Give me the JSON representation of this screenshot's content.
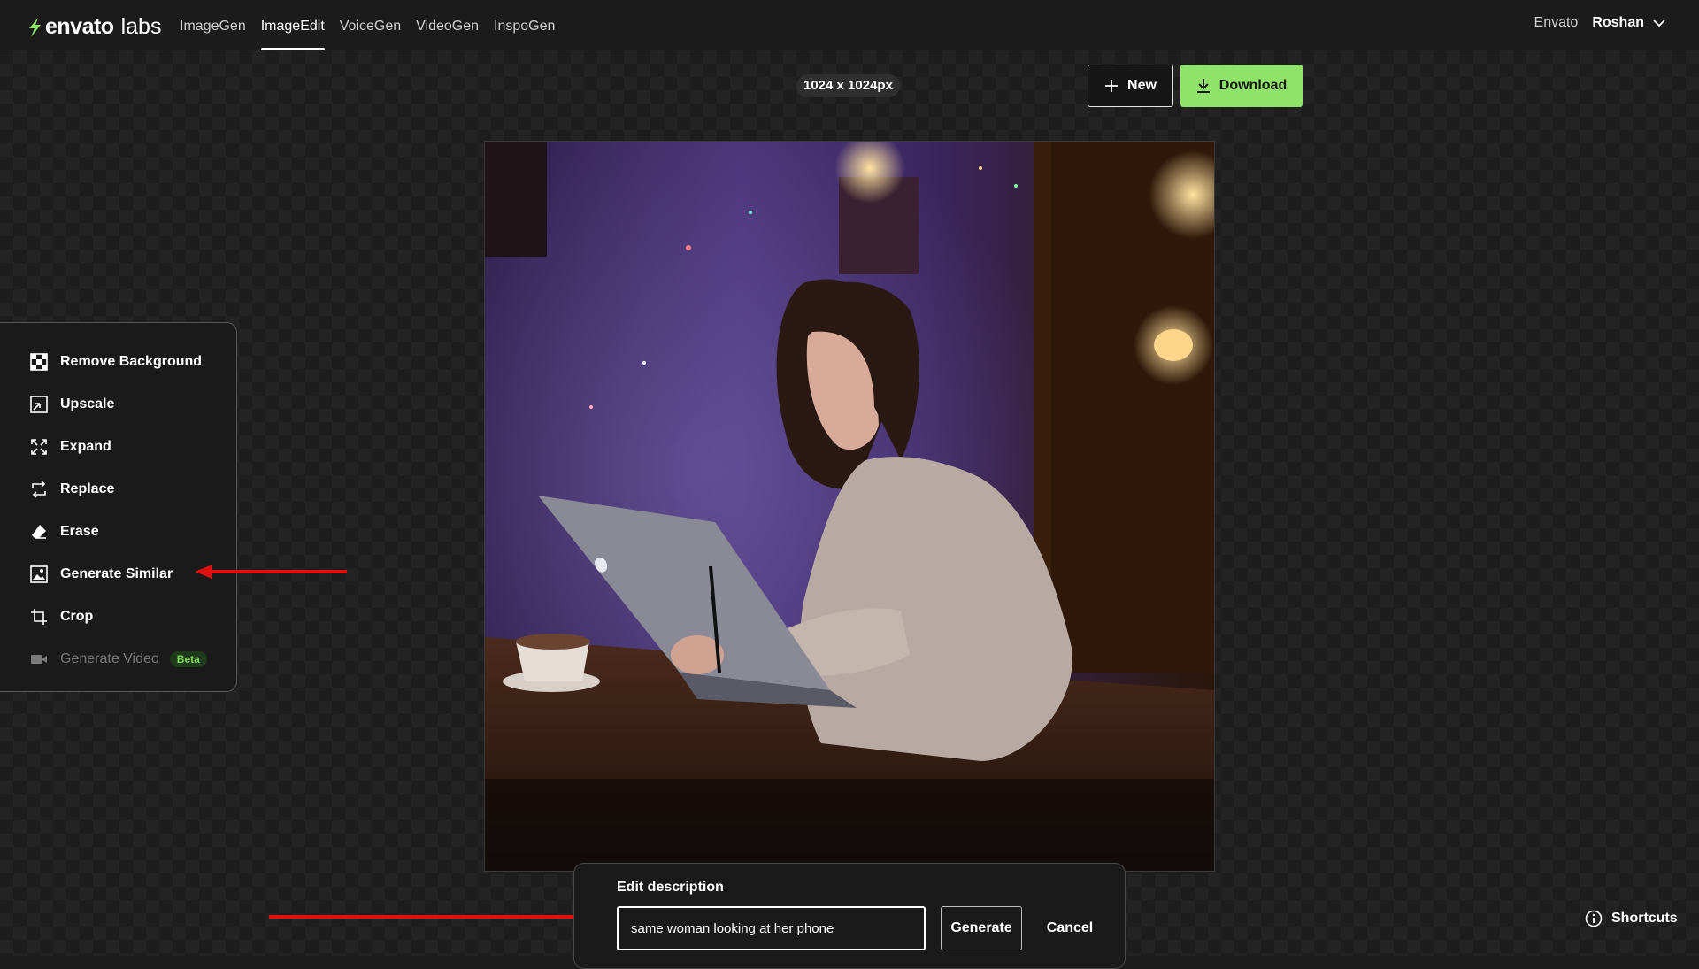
{
  "brand": {
    "name": "envato",
    "sub": "labs",
    "accent": "#8fe36a"
  },
  "nav": {
    "items": [
      {
        "label": "ImageGen",
        "active": false
      },
      {
        "label": "ImageEdit",
        "active": true
      },
      {
        "label": "VoiceGen",
        "active": false
      },
      {
        "label": "VideoGen",
        "active": false
      },
      {
        "label": "InspoGen",
        "active": false
      }
    ]
  },
  "account": {
    "org": "Envato",
    "user": "Roshan"
  },
  "toolbar": {
    "size_badge": "1024 x 1024px",
    "new_label": "New",
    "download_label": "Download"
  },
  "sidebar": {
    "items": [
      {
        "label": "Remove Background",
        "icon": "checkerboard-icon"
      },
      {
        "label": "Upscale",
        "icon": "upscale-icon"
      },
      {
        "label": "Expand",
        "icon": "expand-icon"
      },
      {
        "label": "Replace",
        "icon": "replace-icon"
      },
      {
        "label": "Erase",
        "icon": "eraser-icon"
      },
      {
        "label": "Generate Similar",
        "icon": "image-icon"
      },
      {
        "label": "Crop",
        "icon": "crop-icon"
      },
      {
        "label": "Generate Video",
        "icon": "video-camera-icon",
        "disabled": true,
        "badge": "Beta"
      }
    ]
  },
  "edit": {
    "title": "Edit description",
    "input_value": "same woman looking at her phone",
    "generate_label": "Generate",
    "cancel_label": "Cancel"
  },
  "footer": {
    "shortcuts_label": "Shortcuts"
  },
  "annotation_color": "#e01010"
}
